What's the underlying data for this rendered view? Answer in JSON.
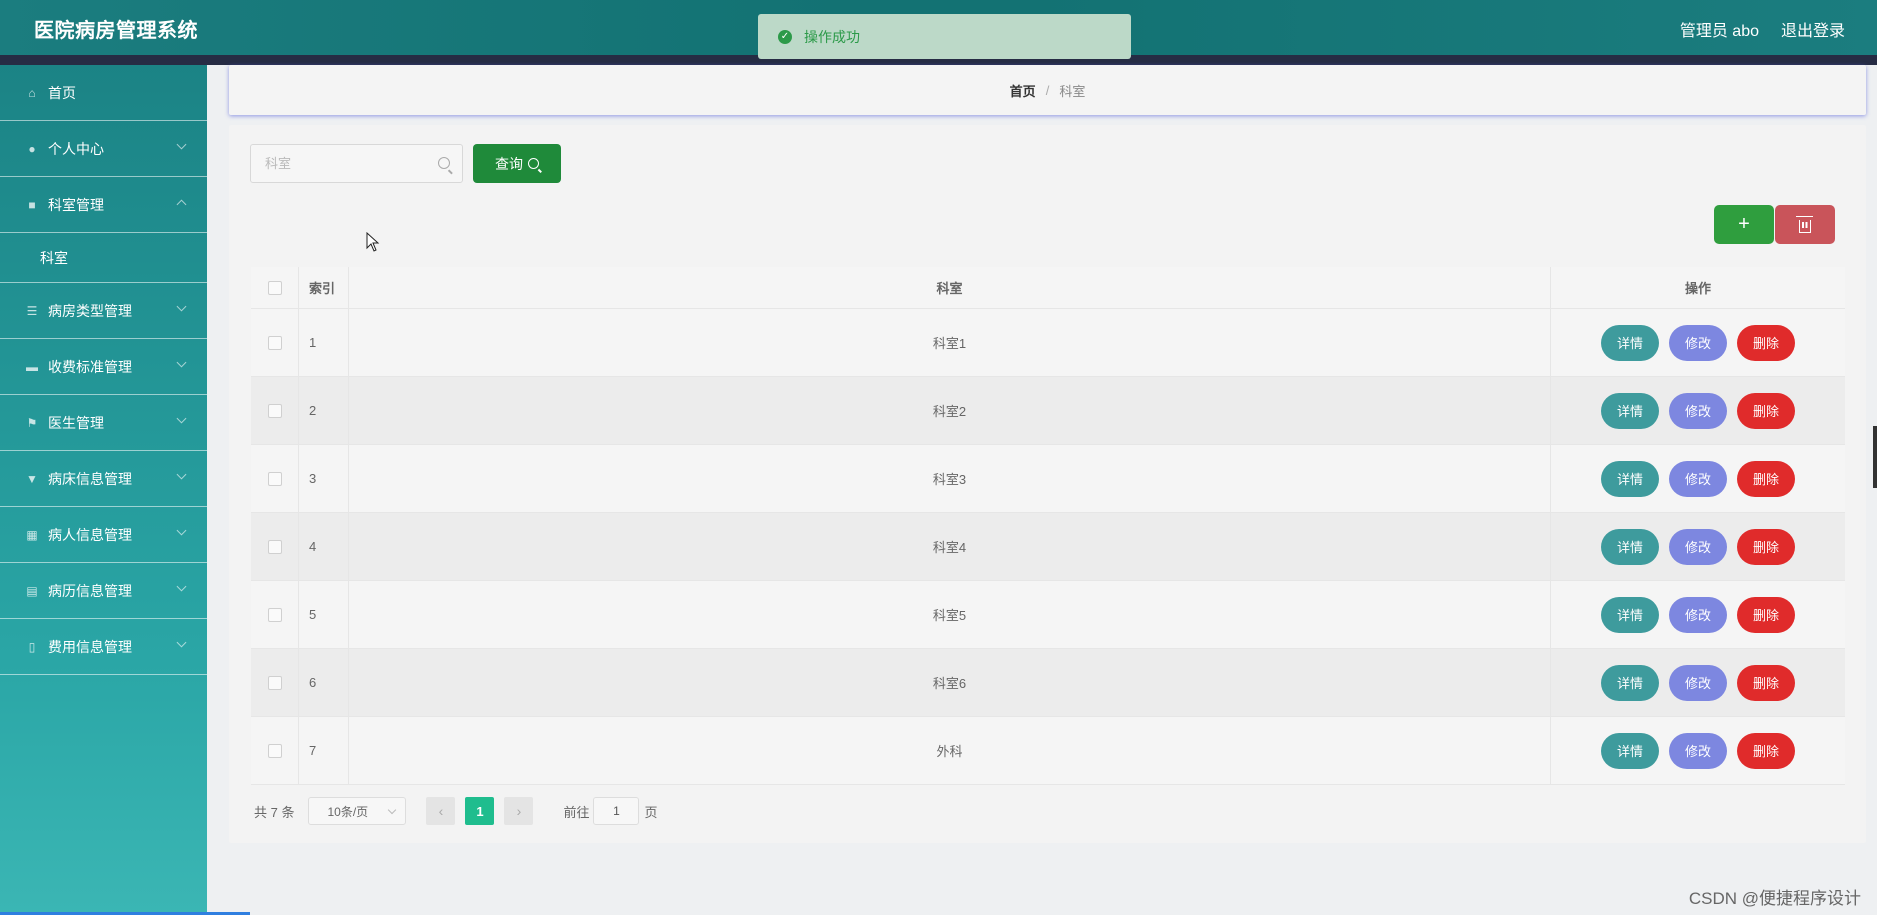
{
  "header": {
    "app_title": "医院病房管理系统",
    "user_label": "管理员 abo",
    "logout_label": "退出登录"
  },
  "toast": {
    "message": "操作成功",
    "status": "success"
  },
  "sidebar": {
    "items": [
      {
        "label": "首页",
        "icon": "home-icon"
      },
      {
        "label": "个人中心",
        "icon": "user-icon",
        "expanded": false
      },
      {
        "label": "科室管理",
        "icon": "office-icon",
        "expanded": true,
        "children": [
          {
            "label": "科室"
          }
        ]
      },
      {
        "label": "病房类型管理",
        "icon": "list-icon",
        "expanded": false
      },
      {
        "label": "收费标准管理",
        "icon": "briefcase-icon",
        "expanded": false
      },
      {
        "label": "医生管理",
        "icon": "flag-icon",
        "expanded": false
      },
      {
        "label": "病床信息管理",
        "icon": "bed-icon",
        "expanded": false
      },
      {
        "label": "病人信息管理",
        "icon": "grid-icon",
        "expanded": false
      },
      {
        "label": "病历信息管理",
        "icon": "record-icon",
        "expanded": false
      },
      {
        "label": "费用信息管理",
        "icon": "fee-icon",
        "expanded": false
      }
    ]
  },
  "breadcrumb": {
    "home": "首页",
    "separator": "/",
    "current": "科室"
  },
  "search": {
    "placeholder": "科室",
    "value": "",
    "button_label": "查询"
  },
  "toolbar": {
    "add_label": "+",
    "delete_icon": "trash-icon"
  },
  "table": {
    "columns": {
      "index": "索引",
      "name": "科室",
      "ops": "操作"
    },
    "rows": [
      {
        "index": "1",
        "name": "科室1"
      },
      {
        "index": "2",
        "name": "科室2"
      },
      {
        "index": "3",
        "name": "科室3"
      },
      {
        "index": "4",
        "name": "科室4"
      },
      {
        "index": "5",
        "name": "科室5"
      },
      {
        "index": "6",
        "name": "科室6"
      },
      {
        "index": "7",
        "name": "外科"
      }
    ],
    "op_labels": {
      "detail": "详情",
      "edit": "修改",
      "delete": "删除"
    }
  },
  "pagination": {
    "total_label": "共 7 条",
    "page_size_label": "10条/页",
    "prev": "‹",
    "next": "›",
    "current_page": "1",
    "goto_label": "前往",
    "goto_value": "1",
    "page_suffix": "页"
  },
  "watermark": "CSDN @便捷程序设计",
  "colors": {
    "header": "#137273",
    "sidebar": "#1b8385",
    "query_button": "#1f8a3a",
    "detail_button": "#3e9b9d",
    "edit_button": "#7d87e0",
    "delete_button": "#e02b2b",
    "page_active": "#1fbd8e"
  }
}
